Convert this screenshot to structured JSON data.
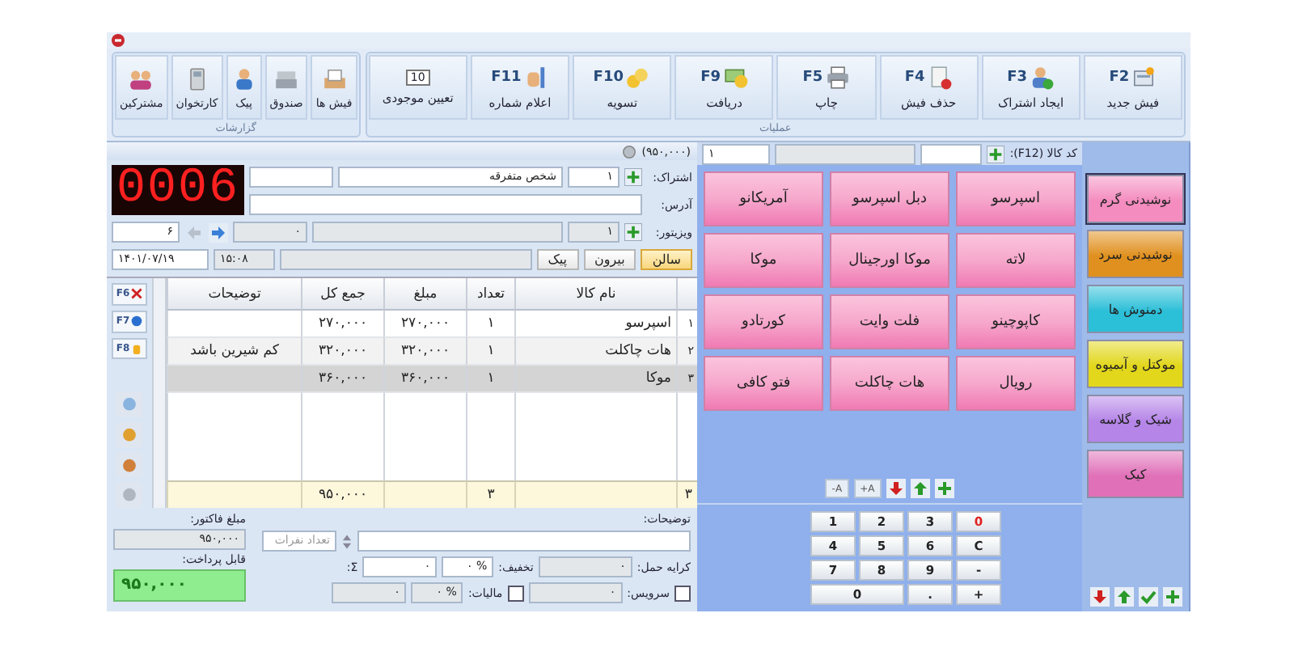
{
  "ribbon": {
    "groups": [
      {
        "label": "عملیات",
        "buttons": [
          {
            "key": "F2",
            "label": "فیش جدید"
          },
          {
            "key": "F3",
            "label": "ایجاد اشتراک"
          },
          {
            "key": "F4",
            "label": "حذف فیش"
          },
          {
            "key": "F5",
            "label": "چاپ"
          },
          {
            "key": "F9",
            "label": "دریافت"
          },
          {
            "key": "F10",
            "label": "تسویه"
          },
          {
            "key": "F11",
            "label": "اعلام شماره"
          },
          {
            "badge": "10",
            "label": "تعیین موجودی"
          }
        ]
      },
      {
        "label": "گزارشات",
        "buttons": [
          {
            "label": "فیش ها"
          },
          {
            "label": "صندوق"
          },
          {
            "label": "پیک"
          },
          {
            "label": "کارتخوان"
          },
          {
            "label": "مشترکین"
          }
        ]
      }
    ]
  },
  "categories": {
    "items": [
      {
        "label": "نوشیدنی گرم",
        "color": "#f48cbf",
        "selected": true
      },
      {
        "label": "نوشیدنی سرد",
        "color": "#e0901e",
        "selected": false
      },
      {
        "label": "دمنوش ها",
        "color": "#2cbfd8",
        "selected": false
      },
      {
        "label": "موکتل و آبمیوه",
        "color": "#e2d71a",
        "selected": false
      },
      {
        "label": "شیک و گلاسه",
        "color": "#b585e8",
        "selected": false
      },
      {
        "label": "کیک",
        "color": "#e070b8",
        "selected": false
      }
    ]
  },
  "products": {
    "code_label": "کد کالا (F12):",
    "quantity": "۱",
    "items": [
      "اسپرسو",
      "دبل اسپرسو",
      "آمریکانو",
      "لاته",
      "موکا اورجینال",
      "موکا",
      "کاپوچینو",
      "فلت وایت",
      "کورتادو",
      "رویال",
      "هات چاکلت",
      "فتو کافی"
    ],
    "font_tools": [
      "A+",
      "A-"
    ],
    "keypad": [
      {
        "label": "0",
        "kind": "danger"
      },
      {
        "label": "3",
        "kind": "digit"
      },
      {
        "label": "2",
        "kind": "digit"
      },
      {
        "label": "1",
        "kind": "digit"
      },
      {
        "label": "C",
        "kind": "digit"
      },
      {
        "label": "6",
        "kind": "digit"
      },
      {
        "label": "5",
        "kind": "digit"
      },
      {
        "label": "4",
        "kind": "digit"
      },
      {
        "label": "-",
        "kind": "digit"
      },
      {
        "label": "9",
        "kind": "digit"
      },
      {
        "label": "8",
        "kind": "digit"
      },
      {
        "label": "7",
        "kind": "digit"
      },
      {
        "label": "+",
        "kind": "digit"
      },
      {
        "label": ".",
        "kind": "digit"
      },
      {
        "label": "0",
        "kind": "wide"
      }
    ]
  },
  "invoice": {
    "total_caption": "(۹۵۰,۰۰۰)",
    "counter": "0006",
    "customer": {
      "label": "اشتراک:",
      "code": "۱",
      "name": "شخص متفرقه"
    },
    "address": {
      "label": "آدرس:"
    },
    "visitor": {
      "label": "ویزیتور:",
      "code": "۱",
      "combo": "۰",
      "number": "۶"
    },
    "order_types": [
      {
        "label": "سالن",
        "selected": true
      },
      {
        "label": "بیرون",
        "selected": false
      },
      {
        "label": "پیک",
        "selected": false
      }
    ],
    "time": "۱۵:۰۸",
    "date": "۱۴۰۱/۰۷/۱۹",
    "side_tools": [
      "F6",
      "F7",
      "F8"
    ],
    "table": {
      "columns": [
        "نام کالا",
        "تعداد",
        "مبلغ",
        "جمع کل",
        "توضیحات"
      ],
      "rows": [
        {
          "number": "۱",
          "name": "اسپرسو",
          "qty": "۱",
          "price": "۲۷۰,۰۰۰",
          "total": "۲۷۰,۰۰۰",
          "selected": false
        },
        {
          "number": "۲",
          "name": "هات چاکلت",
          "qty": "۱",
          "price": "۳۲۰,۰۰۰",
          "total": "۳۲۰,۰۰۰",
          "note": "کم شیرین باشد",
          "selected": false
        },
        {
          "number": "۳",
          "name": "موکا",
          "qty": "۱",
          "price": "۳۶۰,۰۰۰",
          "total": "۳۶۰,۰۰۰",
          "selected": true
        }
      ],
      "footer": {
        "count": "۳",
        "qty": "۳",
        "total": "۹۵۰,۰۰۰"
      }
    },
    "notes_label": "توضیحات:",
    "guests_placeholder": "تعداد نفرات",
    "shipping": {
      "label": "کرایه حمل:",
      "value": "۰"
    },
    "discount": {
      "label": "تخفیف:",
      "unit": "%",
      "percent": "۰",
      "amount": "۰",
      "sum_label": "Σ:"
    },
    "service": {
      "label": "سرویس:",
      "checked": false,
      "value": "۰"
    },
    "tax": {
      "label": "مالیات:",
      "checked": false,
      "unit": "%",
      "percent": "۰",
      "amount": "۰"
    },
    "invoice_amount": {
      "label": "مبلغ فاکتور:",
      "value": "۹۵۰,۰۰۰"
    },
    "payable": {
      "label": "قابل پرداخت:",
      "value": "۹۵۰,۰۰۰"
    }
  }
}
